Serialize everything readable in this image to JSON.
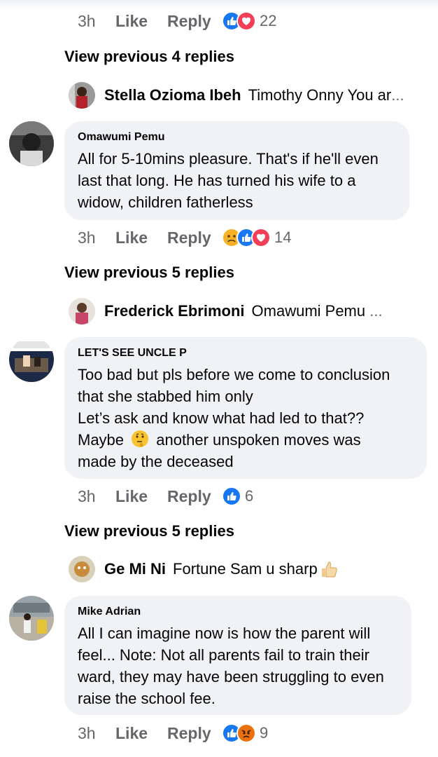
{
  "rows": [
    {
      "time": "3h",
      "like": "Like",
      "reply": "Reply",
      "reactions": [
        "like-emoji",
        "love-emoji"
      ],
      "count": "22"
    },
    {
      "time": "3h",
      "like": "Like",
      "reply": "Reply",
      "reactions": [
        "sad-emoji",
        "like-emoji",
        "love-emoji"
      ],
      "count": "14"
    },
    {
      "time": "3h",
      "like": "Like",
      "reply": "Reply",
      "reactions": [
        "like-emoji"
      ],
      "count": "6"
    },
    {
      "time": "3h",
      "like": "Like",
      "reply": "Reply",
      "reactions": [
        "like-emoji",
        "angry-emoji"
      ],
      "count": "9"
    }
  ],
  "view_previous": [
    "View previous 4 replies",
    "View previous 5 replies",
    "View previous 5 replies"
  ],
  "reply_previews": [
    {
      "name": "Stella Ozioma Ibeh",
      "text": "Timothy Onny You ar",
      "ellipsis": "..."
    },
    {
      "name": "Frederick Ebrimoni",
      "text": "Omawumi Pemu",
      "ellipsis": "..."
    },
    {
      "name": "Ge Mi Ni",
      "text": "Fortune Sam u sharp",
      "ellipsis": ""
    }
  ],
  "comments": [
    {
      "author": "Omawumi Pemu",
      "lines": [
        "All for 5-10mins pleasure. That's if he'll even",
        "last that long. He has turned his wife to a",
        "widow, children fatherless"
      ]
    },
    {
      "author": "LET'S SEE UNCLE P",
      "lines": [
        "Too bad but pls before we come to conclusion",
        "that she stabbed him only",
        "Let’s ask and know what had led to that??",
        "Maybe",
        "another unspoken moves was",
        "made by the deceased"
      ]
    },
    {
      "author": "Mike Adrian",
      "lines": [
        "All I can imagine now is how the parent will",
        "feel... Note: Not all parents fail to train their",
        "ward, they may have been struggling to even",
        "raise the school fee."
      ]
    }
  ],
  "colors": {
    "like": "#1877f2",
    "love": "#f33e58",
    "sad": "#f7b125",
    "angry": "#e9710f",
    "bubble": "#f0f2f5",
    "muted": "#65676b"
  }
}
